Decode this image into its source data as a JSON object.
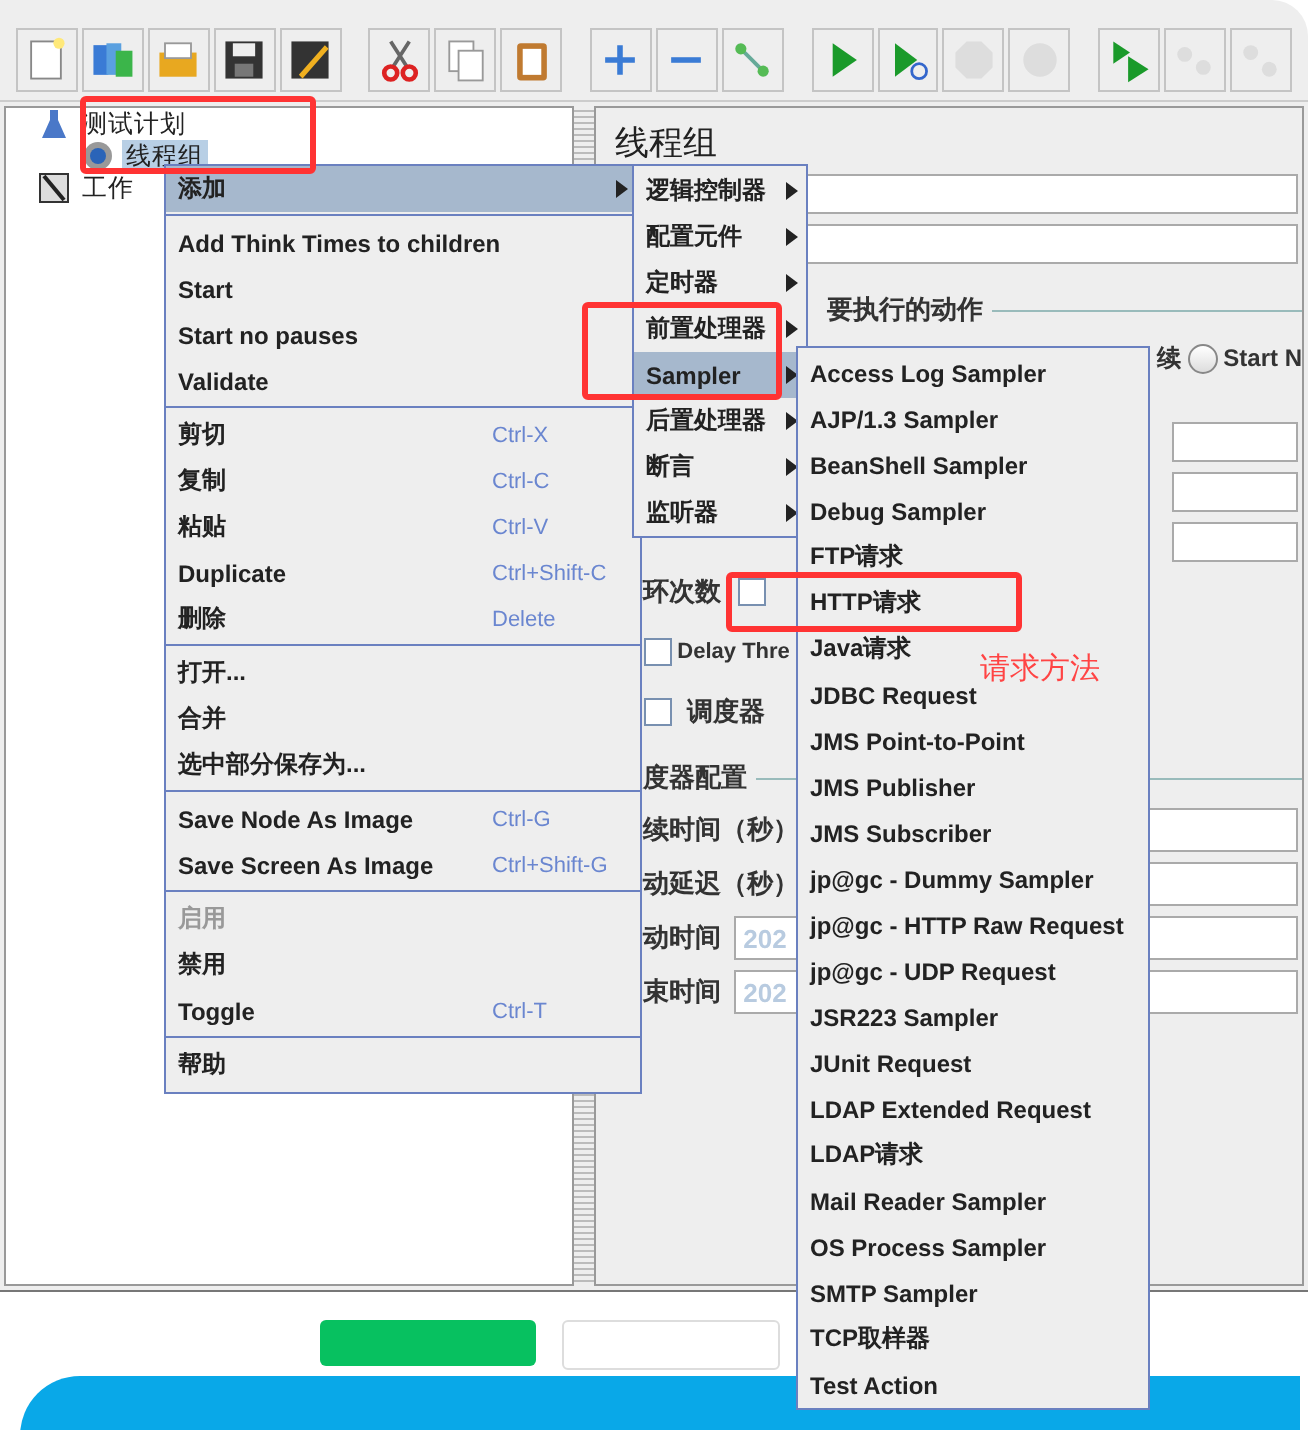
{
  "toolbar": [
    {
      "kind": "new",
      "disabled": false
    },
    {
      "kind": "templates",
      "disabled": false
    },
    {
      "kind": "open",
      "disabled": false
    },
    {
      "kind": "save",
      "disabled": false
    },
    {
      "kind": "edit",
      "disabled": false
    },
    {
      "kind": "separator"
    },
    {
      "kind": "cut",
      "disabled": false
    },
    {
      "kind": "copy",
      "disabled": false
    },
    {
      "kind": "paste",
      "disabled": false
    },
    {
      "kind": "separator"
    },
    {
      "kind": "expand",
      "disabled": false
    },
    {
      "kind": "collapse",
      "disabled": false
    },
    {
      "kind": "toggle",
      "disabled": false
    },
    {
      "kind": "separator"
    },
    {
      "kind": "start",
      "disabled": false
    },
    {
      "kind": "start-no-timer",
      "disabled": false
    },
    {
      "kind": "stop",
      "disabled": true
    },
    {
      "kind": "shutdown",
      "disabled": true
    },
    {
      "kind": "separator"
    },
    {
      "kind": "remote-start",
      "disabled": false
    },
    {
      "kind": "remote-stop",
      "disabled": true
    },
    {
      "kind": "remote-exit",
      "disabled": true
    }
  ],
  "tree": [
    {
      "label": "测试计划",
      "kind": "plan",
      "selected": false,
      "children": [
        {
          "label": "线程组",
          "kind": "threadgroup",
          "selected": true
        }
      ]
    },
    {
      "label": "工作",
      "kind": "workbench",
      "selected": false
    }
  ],
  "panel": {
    "title": "线程组",
    "action_section": "要执行的动作",
    "action_option": "续",
    "radio": {
      "label": "Start N",
      "selected": false
    },
    "loop_label": "环次数",
    "loop_forever_checked": false,
    "delay": {
      "label": "Delay Thre",
      "checked": false
    },
    "scheduler": {
      "label": "调度器",
      "checked": false
    },
    "scheduler_section": "度器配置",
    "scheduler_fields": [
      {
        "label": "续时间（秒）"
      },
      {
        "label": "动延迟（秒）"
      },
      {
        "label": "动时间",
        "placeholder": "202"
      },
      {
        "label": "束时间",
        "placeholder": "202"
      }
    ]
  },
  "context_menu": [
    {
      "kind": "submenu",
      "label": "添加",
      "selected": true
    },
    {
      "kind": "separator"
    },
    {
      "kind": "item",
      "label": "Add Think Times to children",
      "disabled": false
    },
    {
      "kind": "item",
      "label": "Start",
      "disabled": false
    },
    {
      "kind": "item",
      "label": "Start no pauses",
      "disabled": false
    },
    {
      "kind": "item",
      "label": "Validate",
      "disabled": false
    },
    {
      "kind": "separator"
    },
    {
      "kind": "item",
      "label": "剪切",
      "shortcut": "Ctrl-X",
      "disabled": false
    },
    {
      "kind": "item",
      "label": "复制",
      "shortcut": "Ctrl-C",
      "disabled": false
    },
    {
      "kind": "item",
      "label": "粘贴",
      "shortcut": "Ctrl-V",
      "disabled": false
    },
    {
      "kind": "item",
      "label": "Duplicate",
      "shortcut": "Ctrl+Shift-C",
      "disabled": false
    },
    {
      "kind": "item",
      "label": "删除",
      "shortcut": "Delete",
      "disabled": false
    },
    {
      "kind": "separator"
    },
    {
      "kind": "item",
      "label": "打开...",
      "disabled": false
    },
    {
      "kind": "item",
      "label": "合并",
      "disabled": false
    },
    {
      "kind": "item",
      "label": "选中部分保存为...",
      "disabled": false
    },
    {
      "kind": "separator"
    },
    {
      "kind": "item",
      "label": "Save Node As Image",
      "shortcut": "Ctrl-G",
      "disabled": false
    },
    {
      "kind": "item",
      "label": "Save Screen As Image",
      "shortcut": "Ctrl+Shift-G",
      "disabled": false
    },
    {
      "kind": "separator"
    },
    {
      "kind": "item",
      "label": "启用",
      "disabled": true
    },
    {
      "kind": "item",
      "label": "禁用",
      "disabled": false
    },
    {
      "kind": "item",
      "label": "Toggle",
      "shortcut": "Ctrl-T",
      "disabled": false
    },
    {
      "kind": "separator"
    },
    {
      "kind": "item",
      "label": "帮助",
      "disabled": false
    }
  ],
  "add_menu": [
    {
      "label": "逻辑控制器",
      "selected": false
    },
    {
      "label": "配置元件",
      "selected": false
    },
    {
      "label": "定时器",
      "selected": false
    },
    {
      "label": "前置处理器",
      "selected": false
    },
    {
      "label": "Sampler",
      "selected": true
    },
    {
      "label": "后置处理器",
      "selected": false
    },
    {
      "label": "断言",
      "selected": false
    },
    {
      "label": "监听器",
      "selected": false
    }
  ],
  "sampler_menu": [
    "Access Log Sampler",
    "AJP/1.3 Sampler",
    "BeanShell Sampler",
    "Debug Sampler",
    "FTP请求",
    "HTTP请求",
    "Java请求",
    "JDBC Request",
    "JMS Point-to-Point",
    "JMS Publisher",
    "JMS Subscriber",
    "jp@gc - Dummy Sampler",
    "jp@gc - HTTP Raw Request",
    "jp@gc - UDP Request",
    "JSR223 Sampler",
    "JUnit Request",
    "LDAP Extended Request",
    "LDAP请求",
    "Mail Reader Sampler",
    "OS Process Sampler",
    "SMTP Sampler",
    "TCP取样器",
    "Test Action"
  ],
  "annotation": {
    "note": "请求方法"
  }
}
